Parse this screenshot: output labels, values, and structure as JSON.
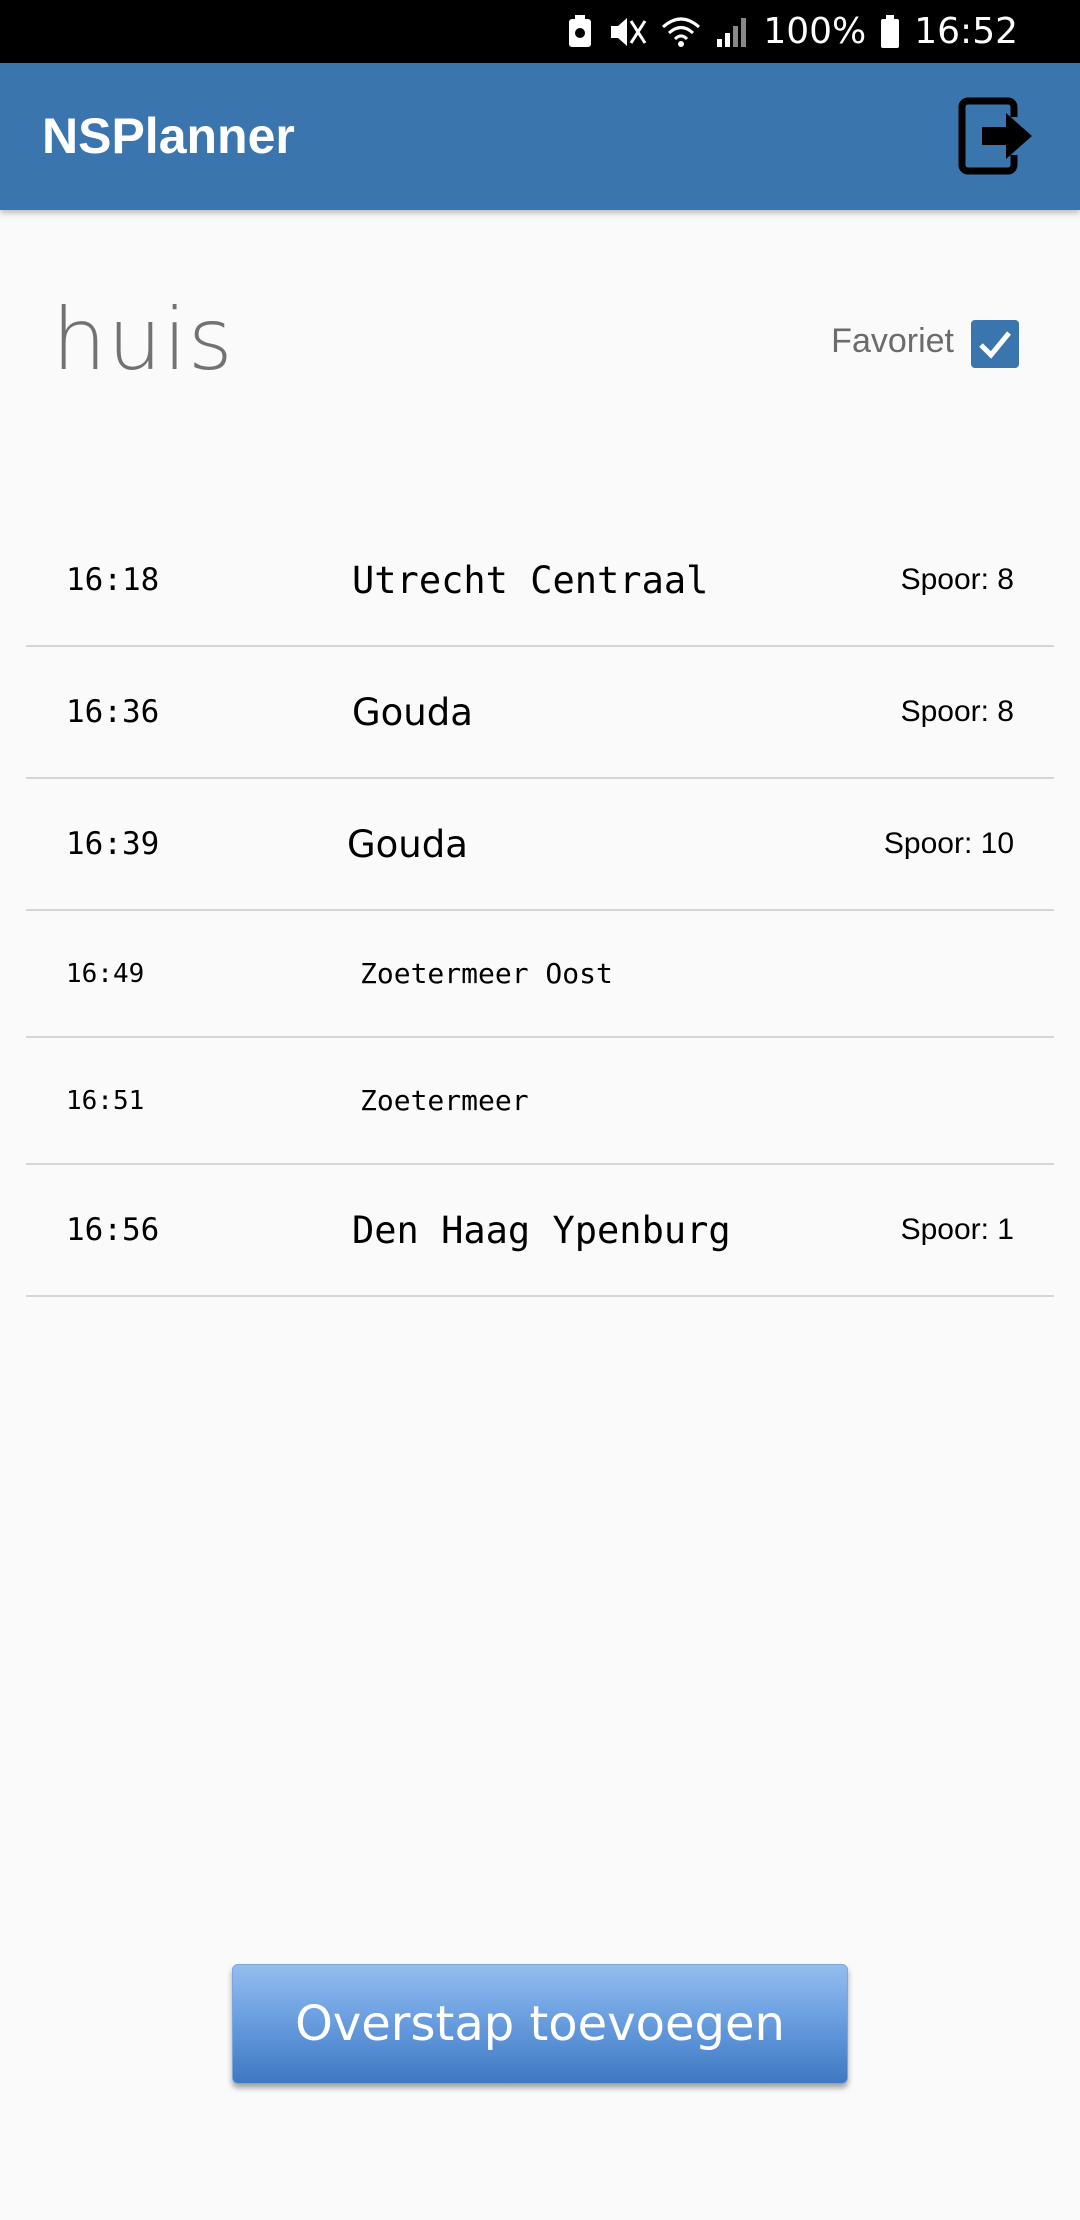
{
  "status_bar": {
    "battery": "100%",
    "time": "16:52"
  },
  "app_bar": {
    "title": "NSPlanner",
    "logout_icon": "logout-icon"
  },
  "group": {
    "title": "huis",
    "favorite_label": "Favoriet",
    "favorite_checked": true
  },
  "trips": [
    {
      "time": "16:18",
      "destination": "Utrecht Centraal",
      "track": "Spoor: 8"
    },
    {
      "time": "16:36",
      "destination": "Gouda",
      "track": "Spoor: 8"
    },
    {
      "time": "16:39",
      "destination": "Gouda",
      "track": "Spoor: 10"
    },
    {
      "time": "16:49",
      "destination": "Zoetermeer Oost",
      "track": ""
    },
    {
      "time": "16:51",
      "destination": "Zoetermeer",
      "track": ""
    },
    {
      "time": "16:56",
      "destination": "Den Haag Ypenburg",
      "track": "Spoor: 1"
    }
  ],
  "actions": {
    "add_transfer_label": "Overstap toevoegen"
  },
  "colors": {
    "primary": "#3b75ad",
    "status_bar": "#000000",
    "background": "#fafafa"
  }
}
